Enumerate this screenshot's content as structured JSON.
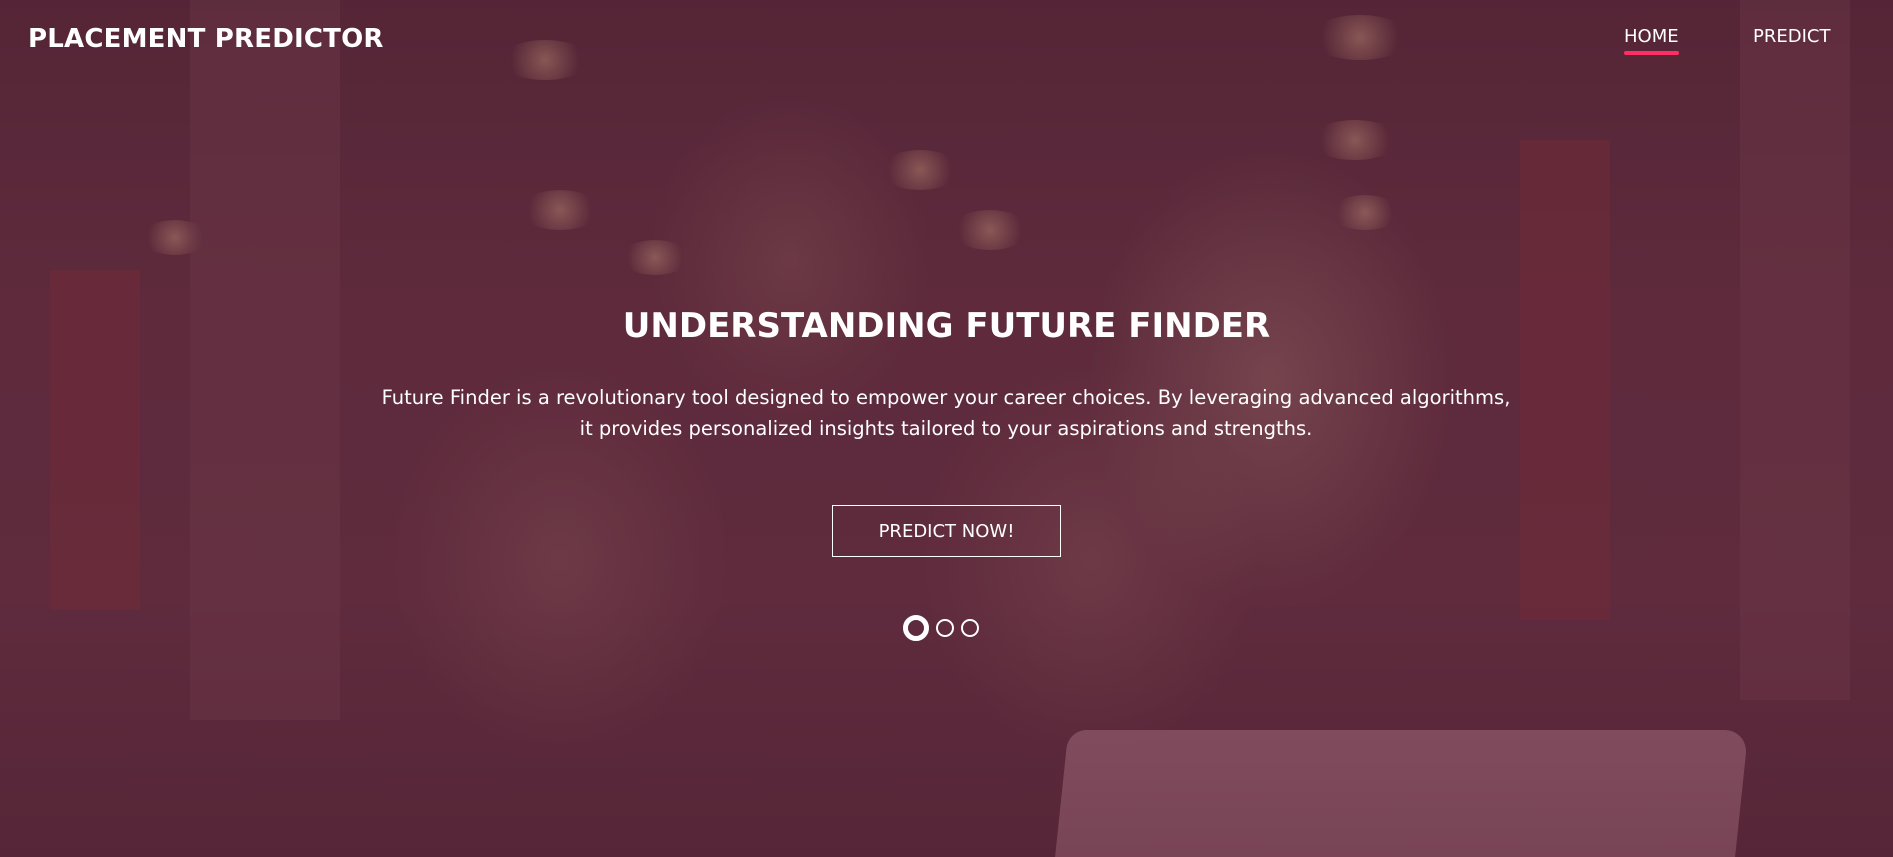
{
  "brand": "PLACEMENT PREDICTOR",
  "nav": {
    "home": "HOME",
    "predict": "PREDICT",
    "active": "home"
  },
  "hero": {
    "headline": "UNDERSTANDING FUTURE FINDER",
    "description_line1": "Future Finder is a revolutionary tool designed to empower your career choices. By leveraging advanced algorithms,",
    "description_line2": "it provides personalized insights tailored to your aspirations and strengths.",
    "cta": "PREDICT NOW!"
  },
  "carousel": {
    "slide_count": 3,
    "active_index": 0
  },
  "colors": {
    "accent": "#ff2f63",
    "overlay": "#50192d",
    "text": "#ffffff"
  },
  "background_image": "group-of-students-looking-at-laptop"
}
